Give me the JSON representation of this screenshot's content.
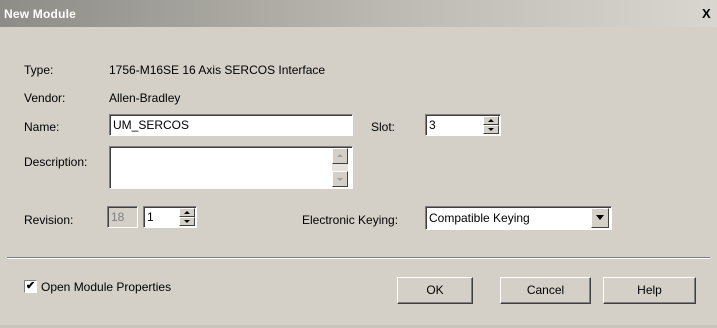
{
  "window": {
    "title": "New Module",
    "close_glyph": "X"
  },
  "form": {
    "type_label": "Type:",
    "type_value": "1756-M16SE 16 Axis SERCOS Interface",
    "vendor_label": "Vendor:",
    "vendor_value": "Allen-Bradley",
    "name_label": "Name:",
    "name_value": "UM_SERCOS",
    "slot_label": "Slot:",
    "slot_value": "3",
    "description_label": "Description:",
    "description_value": "",
    "revision_label": "Revision:",
    "revision_major": "18",
    "revision_minor": "1",
    "keying_label": "Electronic Keying:",
    "keying_value": "Compatible Keying"
  },
  "footer": {
    "open_props_label": "Open Module Properties",
    "open_props_checked": true,
    "check_glyph": "✔",
    "ok_label": "OK",
    "cancel_label": "Cancel",
    "help_label": "Help"
  }
}
